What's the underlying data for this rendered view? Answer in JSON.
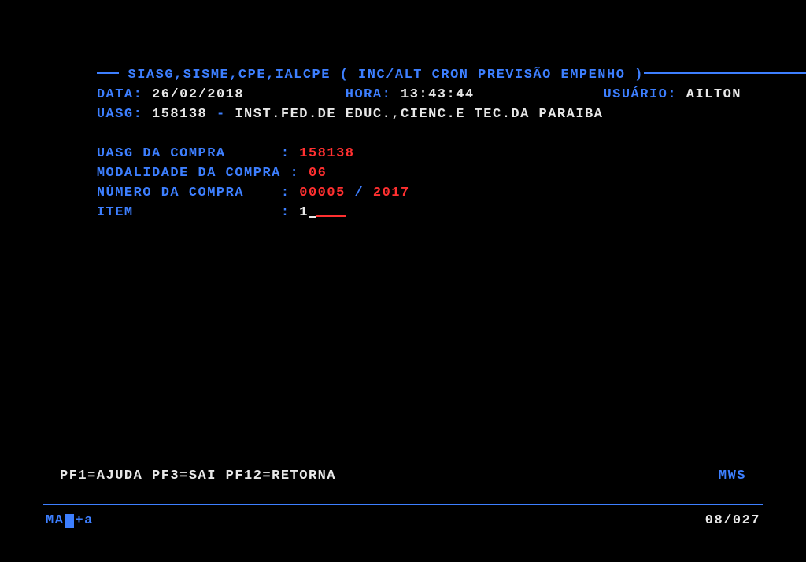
{
  "header": {
    "path": "SIASG,SISME,CPE,IALCPE",
    "title": "( INC/ALT CRON PREVISÃO EMPENHO )"
  },
  "info_line1": {
    "data_label": "DATA:",
    "data_value": "26/02/2018",
    "hora_label": "HORA:",
    "hora_value": "13:43:44",
    "usuario_label": "USUÁRIO:",
    "usuario_value": "AILTON"
  },
  "info_line2": {
    "uasg_label": "UASG:",
    "uasg_code": "158138",
    "dash": "-",
    "uasg_name": "INST.FED.DE EDUC.,CIENC.E TEC.DA PARAIBA"
  },
  "fields": {
    "uasg_compra_label": "UASG DA COMPRA      :",
    "uasg_compra_value": "158138",
    "modalidade_label": "MODALIDADE DA COMPRA :",
    "modalidade_value": "06",
    "numero_label": "NÚMERO DA COMPRA    :",
    "numero_value": "00005",
    "numero_sep": "/",
    "numero_year": "2017",
    "item_label": "ITEM                :",
    "item_value": "1"
  },
  "footer": {
    "pf_keys": "PF1=AJUDA PF3=SAI PF12=RETORNA",
    "right": "MWS"
  },
  "status": {
    "ma": "MA",
    "plus": "+",
    "a": "a",
    "position": "08/027"
  }
}
